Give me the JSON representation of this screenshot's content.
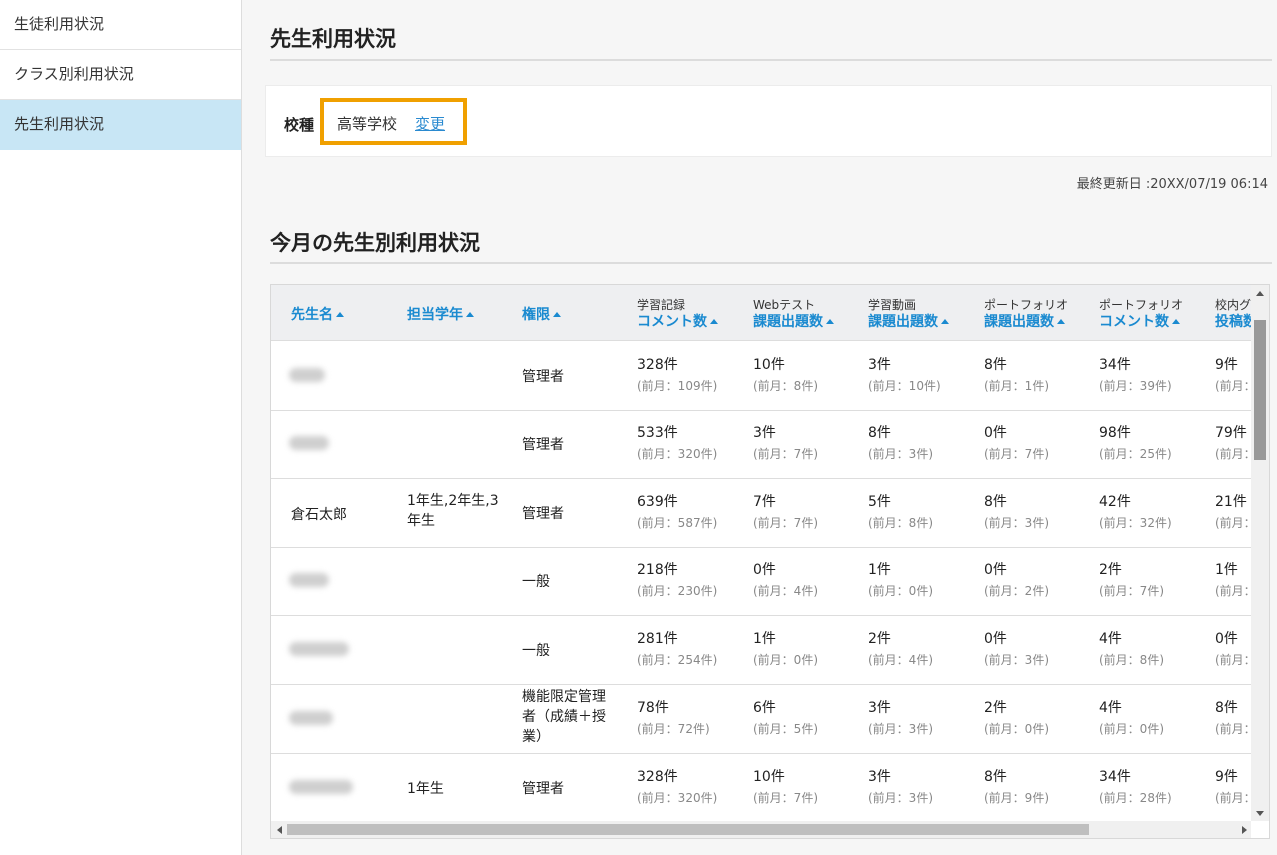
{
  "sidebar": {
    "items": [
      {
        "label": "生徒利用状況"
      },
      {
        "label": "クラス別利用状況"
      },
      {
        "label": "先生利用状況"
      }
    ]
  },
  "page": {
    "title": "先生利用状況",
    "filter": {
      "label": "校種",
      "value": "高等学校",
      "change_link": "変更"
    },
    "last_updated": "最終更新日 :20XX/07/19 06:14",
    "section_title": "今月の先生別利用状況"
  },
  "table": {
    "headers": [
      {
        "sub": "",
        "main": "先生名"
      },
      {
        "sub": "",
        "main": "担当学年"
      },
      {
        "sub": "",
        "main": "権限"
      },
      {
        "sub": "学習記録",
        "main": "コメント数"
      },
      {
        "sub": "Webテスト",
        "main": "課題出題数"
      },
      {
        "sub": "学習動画",
        "main": "課題出題数"
      },
      {
        "sub": "ポートフォリオ",
        "main": "課題出題数"
      },
      {
        "sub": "ポートフォリオ",
        "main": "コメント数"
      },
      {
        "sub": "校内グ",
        "main": "投稿数"
      }
    ],
    "rows": [
      {
        "name": "",
        "grade": "",
        "role": "管理者",
        "stats": [
          {
            "v": "328件",
            "p": "(前月：109件)"
          },
          {
            "v": "10件",
            "p": "(前月：8件)"
          },
          {
            "v": "3件",
            "p": "(前月：10件)"
          },
          {
            "v": "8件",
            "p": "(前月：1件)"
          },
          {
            "v": "34件",
            "p": "(前月：39件)"
          },
          {
            "v": "9件",
            "p": "(前月："
          }
        ]
      },
      {
        "name": "",
        "grade": "",
        "role": "管理者",
        "stats": [
          {
            "v": "533件",
            "p": "(前月：320件)"
          },
          {
            "v": "3件",
            "p": "(前月：7件)"
          },
          {
            "v": "8件",
            "p": "(前月：3件)"
          },
          {
            "v": "0件",
            "p": "(前月：7件)"
          },
          {
            "v": "98件",
            "p": "(前月：25件)"
          },
          {
            "v": "79件",
            "p": "(前月："
          }
        ]
      },
      {
        "name": "倉石太郎",
        "grade": "1年生,2年生,3年生",
        "role": "管理者",
        "stats": [
          {
            "v": "639件",
            "p": "(前月：587件)"
          },
          {
            "v": "7件",
            "p": "(前月：7件)"
          },
          {
            "v": "5件",
            "p": "(前月：8件)"
          },
          {
            "v": "8件",
            "p": "(前月：3件)"
          },
          {
            "v": "42件",
            "p": "(前月：32件)"
          },
          {
            "v": "21件",
            "p": "(前月："
          }
        ]
      },
      {
        "name": "",
        "grade": "",
        "role": "一般",
        "stats": [
          {
            "v": "218件",
            "p": "(前月：230件)"
          },
          {
            "v": "0件",
            "p": "(前月：4件)"
          },
          {
            "v": "1件",
            "p": "(前月：0件)"
          },
          {
            "v": "0件",
            "p": "(前月：2件)"
          },
          {
            "v": "2件",
            "p": "(前月：7件)"
          },
          {
            "v": "1件",
            "p": "(前月："
          }
        ]
      },
      {
        "name": "",
        "grade": "",
        "role": "一般",
        "stats": [
          {
            "v": "281件",
            "p": "(前月：254件)"
          },
          {
            "v": "1件",
            "p": "(前月：0件)"
          },
          {
            "v": "2件",
            "p": "(前月：4件)"
          },
          {
            "v": "0件",
            "p": "(前月：3件)"
          },
          {
            "v": "4件",
            "p": "(前月：8件)"
          },
          {
            "v": "0件",
            "p": "(前月："
          }
        ]
      },
      {
        "name": "",
        "grade": "",
        "role": "機能限定管理者（成績＋授業）",
        "stats": [
          {
            "v": "78件",
            "p": "(前月：72件)"
          },
          {
            "v": "6件",
            "p": "(前月：5件)"
          },
          {
            "v": "3件",
            "p": "(前月：3件)"
          },
          {
            "v": "2件",
            "p": "(前月：0件)"
          },
          {
            "v": "4件",
            "p": "(前月：0件)"
          },
          {
            "v": "8件",
            "p": "(前月："
          }
        ]
      },
      {
        "name": "",
        "grade": "1年生",
        "role": "管理者",
        "stats": [
          {
            "v": "328件",
            "p": "(前月：320件)"
          },
          {
            "v": "10件",
            "p": "(前月：7件)"
          },
          {
            "v": "3件",
            "p": "(前月：3件)"
          },
          {
            "v": "8件",
            "p": "(前月：9件)"
          },
          {
            "v": "34件",
            "p": "(前月：28件)"
          },
          {
            "v": "9件",
            "p": "(前月："
          }
        ]
      }
    ]
  }
}
